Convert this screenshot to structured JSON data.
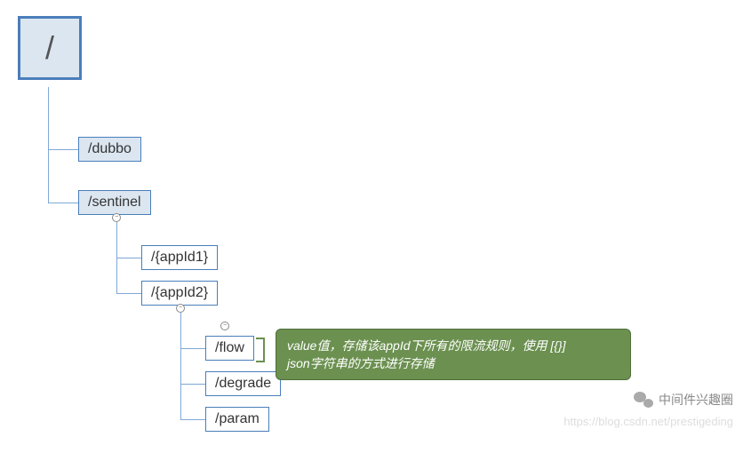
{
  "tree": {
    "root": "/",
    "level1": {
      "dubbo": "/dubbo",
      "sentinel": "/sentinel"
    },
    "level2": {
      "app1": "/{appId1}",
      "app2": "/{appId2}"
    },
    "level3": {
      "flow": "/flow",
      "degrade": "/degrade",
      "param": "/param"
    }
  },
  "tooltip": {
    "line1": "value值，存储该appId下所有的限流规则，使用 [{}]",
    "line2": "json字符串的方式进行存储"
  },
  "watermark": {
    "wechat": "中间件兴趣圈",
    "url": "https://blog.csdn.net/prestigeding"
  },
  "toggle_symbol": "−"
}
